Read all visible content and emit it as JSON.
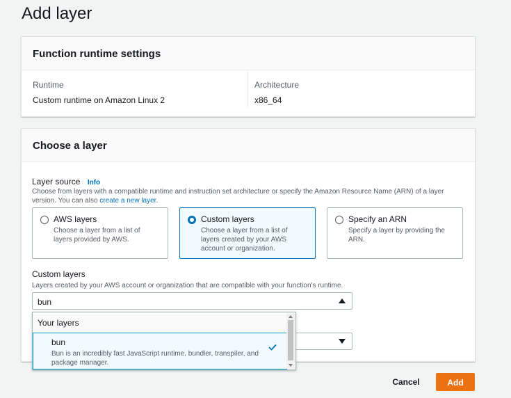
{
  "page": {
    "title": "Add layer"
  },
  "runtime_panel": {
    "title": "Function runtime settings",
    "runtime_label": "Runtime",
    "runtime_value": "Custom runtime on Amazon Linux 2",
    "architecture_label": "Architecture",
    "architecture_value": "x86_64"
  },
  "layer_panel": {
    "title": "Choose a layer",
    "layer_source": {
      "label": "Layer source",
      "info_link": "Info",
      "description": "Choose from layers with a compatible runtime and instruction set architecture or specify the Amazon Resource Name (ARN) of a layer version. You can also",
      "create_link": "create a new layer",
      "description_end": ".",
      "options": [
        {
          "title": "AWS layers",
          "description": "Choose a layer from a list of layers provided by AWS.",
          "selected": false
        },
        {
          "title": "Custom layers",
          "description": "Choose a layer from a list of layers created by your AWS account or organization.",
          "selected": true
        },
        {
          "title": "Specify an ARN",
          "description": "Specify a layer by providing the ARN.",
          "selected": false
        }
      ]
    },
    "custom_layers": {
      "label": "Custom layers",
      "description": "Layers created by your AWS account or organization that are compatible with your function's runtime.",
      "selected_value": "bun",
      "dropdown": {
        "group_label": "Your layers",
        "options": [
          {
            "title": "bun",
            "description": "Bun is an incredibly fast JavaScript runtime, bundler, transpiler, and package manager.",
            "checked": true
          }
        ]
      }
    }
  },
  "footer": {
    "cancel_label": "Cancel",
    "add_label": "Add"
  },
  "colors": {
    "accent": "#0073bb",
    "primary_button": "#ec7211"
  },
  "icons": [
    "radio-icon",
    "caret-up-icon",
    "caret-down-icon",
    "check-icon"
  ]
}
